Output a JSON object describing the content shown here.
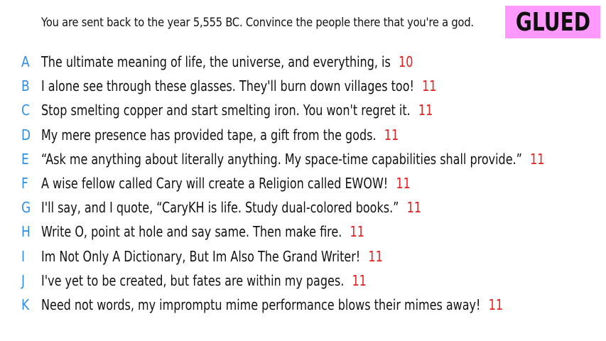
{
  "prompt": "You are sent back to the year 5,555 BC. Convince the people there that you're a god.",
  "badge": "GLUED",
  "accent_colors": {
    "letter": "#2e8fe6",
    "score": "#e61e1e",
    "badge_bg": "#ff99ff"
  },
  "entries": [
    {
      "letter": "A",
      "text": "The ultimate meaning of life, the universe, and everything, is",
      "score": "10"
    },
    {
      "letter": "B",
      "text": "I alone see through these glasses. They'll burn down villages too!",
      "score": "11"
    },
    {
      "letter": "C",
      "text": "Stop smelting copper and start smelting iron. You won't regret it.",
      "score": "11"
    },
    {
      "letter": "D",
      "text": "My mere presence has provided tape, a gift from the gods.",
      "score": "11"
    },
    {
      "letter": "E",
      "text": "“Ask me anything about literally anything. My space-time capabilities shall provide.”",
      "score": "11"
    },
    {
      "letter": "F",
      "text": "A wise fellow called Cary will create a Religion called EWOW!",
      "score": "11"
    },
    {
      "letter": "G",
      "text": "I'll say, and I quote, “CaryKH is life. Study dual-colored books.”",
      "score": "11"
    },
    {
      "letter": "H",
      "text": "Write O, point at hole and say same. Then make fire.",
      "score": "11"
    },
    {
      "letter": "I",
      "text": "Im Not Only A Dictionary, But Im Also The Grand Writer!",
      "score": "11"
    },
    {
      "letter": "J",
      "text": "I've yet to be created, but fates are within my pages.",
      "score": "11"
    },
    {
      "letter": "K",
      "text": "Need not words, my impromptu mime performance blows their mimes away!",
      "score": "11"
    }
  ]
}
